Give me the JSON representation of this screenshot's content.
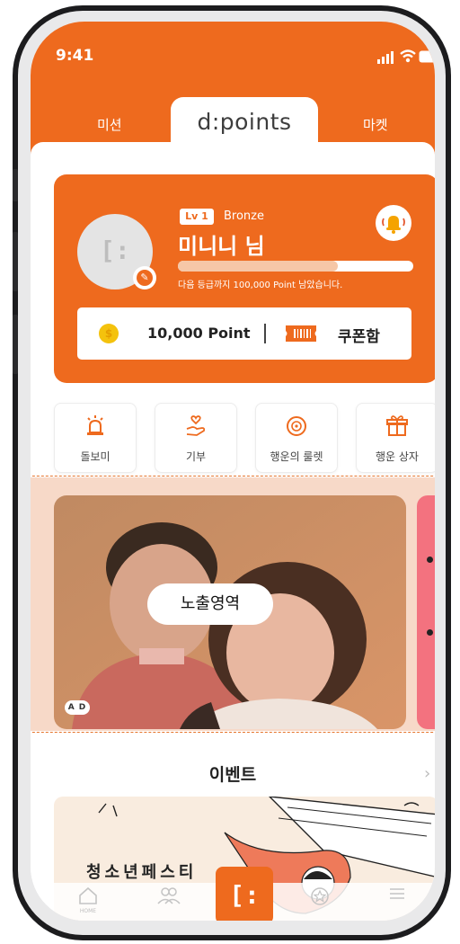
{
  "status_bar": {
    "time": "9:41"
  },
  "header": {
    "tabs": [
      {
        "label": "미션"
      },
      {
        "label": "d:points"
      },
      {
        "label": "마켓"
      }
    ],
    "active_tab": "d:points"
  },
  "profile": {
    "level_badge": "Lv 1",
    "grade": "Bronze",
    "name": "미니니 님",
    "progress_fraction": 0.68,
    "progress_text": "다음 등급까지 100,000 Point 남았습니다.",
    "points": "10,000 Point",
    "coupon_label": "쿠폰함"
  },
  "quick_menu": [
    {
      "label": "돌보미",
      "icon": "alarm-icon"
    },
    {
      "label": "기부",
      "icon": "donation-hand-icon"
    },
    {
      "label": "행운의 룰렛",
      "icon": "roulette-icon"
    },
    {
      "label": "행운 상자",
      "icon": "gift-box-icon"
    }
  ],
  "banner": {
    "exposure_label": "노출영역",
    "ad_badge": "A D"
  },
  "event": {
    "title": "이벤트",
    "festival_text": "청소년페스티"
  },
  "colors": {
    "brand_orange": "#ee6a1e",
    "light_orange": "#f7d9c8",
    "pink": "#f3727f"
  }
}
